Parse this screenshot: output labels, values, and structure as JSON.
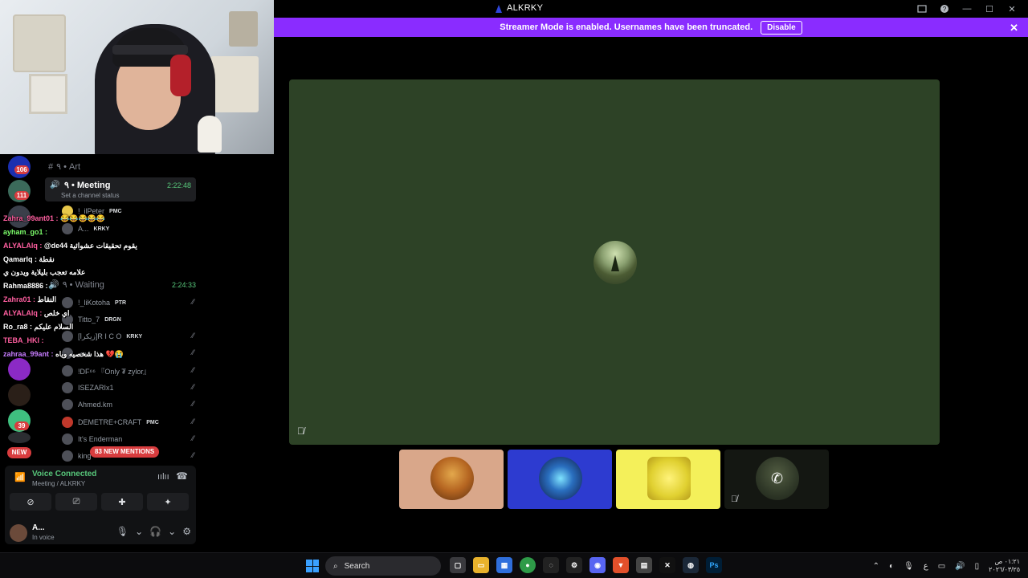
{
  "window": {
    "app_title": "ALKRKY",
    "controls": [
      "cast-icon",
      "help-icon",
      "minimize-icon",
      "maximize-icon",
      "close-icon"
    ]
  },
  "banner": {
    "text": "Streamer Mode is enabled. Usernames have been truncated.",
    "disable_label": "Disable"
  },
  "guilds": {
    "badges": [
      "106",
      "111",
      "39"
    ],
    "new_label": "NEW"
  },
  "channels": {
    "art": "٩ • Art",
    "meeting": {
      "name": "٩ • Meeting",
      "timer": "2:22:48",
      "status": "Set a channel status"
    },
    "waiting": {
      "name": "٩ • Waiting",
      "timer": "2:24:33"
    },
    "members_meeting": [
      {
        "name": "!_ilPeter",
        "tag": "PMC"
      },
      {
        "name": "A...",
        "tag": "KRKY"
      }
    ],
    "members_waiting": [
      {
        "name": "!_liKotoha",
        "tag": "PTR"
      },
      {
        "name": "Titto_7",
        "tag": "DRGN"
      },
      {
        "name": "[زيكرا]R I C O",
        "tag": "KRKY"
      },
      {
        "name": "عدي",
        "tag": ""
      },
      {
        "name": "!DF⁶⁶ 『Only ₮ zylor』",
        "tag": ""
      },
      {
        "name": "ISEZARIx1",
        "tag": ""
      },
      {
        "name": "Ahmed.km",
        "tag": ""
      },
      {
        "name": "DEMETRE+CRAFT",
        "tag": "PMC"
      },
      {
        "name": "It's Enderman",
        "tag": ""
      },
      {
        "name": "king",
        "tag": ""
      }
    ],
    "new_mentions": "83 NEW MENTIONS"
  },
  "chat": [
    {
      "user": "Zahra_99ant01 :",
      "msg": "😂😂😂😂😂",
      "color": "#ff5fa0"
    },
    {
      "user": "ayham_go1 :",
      "msg": "",
      "color": "#7dff6b"
    },
    {
      "user": "ALYALAlq :",
      "msg": "@de44 يقوم تحقيقات عشوائية",
      "color": "#ff5fa0"
    },
    {
      "user": "Qamarlq :",
      "msg": "نقطة",
      "color": "#ffffff"
    },
    {
      "user": "",
      "msg": "علامه تعجب بليلاية ويدون ي",
      "color": "#ffffff"
    },
    {
      "user": "Rahma8886 :",
      "msg": "",
      "color": "#ffffff"
    },
    {
      "user": "Zahra01 :",
      "msg": "النقاط",
      "color": "#ff5fa0"
    },
    {
      "user": "ALYALAlq :",
      "msg": "اي خلص",
      "color": "#ff5fa0"
    },
    {
      "user": "Ro_ra8 :",
      "msg": "السلام عليكم",
      "color": "#ffffff"
    },
    {
      "user": "TEBA_HKI :",
      "msg": "",
      "color": "#ff5fa0"
    },
    {
      "user": "zahraa_99ant :",
      "msg": "هذا شخصيه وياه 💔😭",
      "color": "#c77dff"
    }
  ],
  "voice": {
    "status": "Voice Connected",
    "location": "Meeting / ALKRKY",
    "user_name": "A...",
    "user_status": "In voice"
  },
  "taskbar": {
    "search_placeholder": "Search",
    "clock_time": "٠١:٢١ ص",
    "clock_date": "٢٠٢٦/٠٣/٢٥",
    "lang": "ع"
  },
  "colors": {
    "banner": "#8a2cff",
    "stage": "#2d4226",
    "voice_connected": "#57c67a",
    "badge": "#d83c3e"
  }
}
